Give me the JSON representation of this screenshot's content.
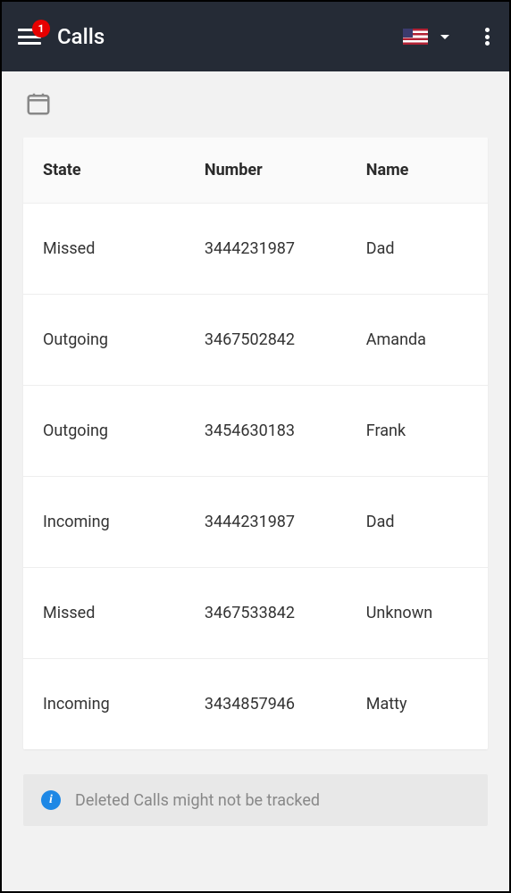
{
  "header": {
    "title": "Calls",
    "badge_count": "1"
  },
  "table": {
    "columns": {
      "state": "State",
      "number": "Number",
      "name": "Name"
    },
    "rows": [
      {
        "state": "Missed",
        "number": "3444231987",
        "name": "Dad"
      },
      {
        "state": "Outgoing",
        "number": "3467502842",
        "name": "Amanda"
      },
      {
        "state": "Outgoing",
        "number": "3454630183",
        "name": "Frank"
      },
      {
        "state": "Incoming",
        "number": "3444231987",
        "name": "Dad"
      },
      {
        "state": "Missed",
        "number": "3467533842",
        "name": "Unknown"
      },
      {
        "state": "Incoming",
        "number": "3434857946",
        "name": "Matty"
      }
    ]
  },
  "info": {
    "message": "Deleted Calls might not be tracked"
  }
}
